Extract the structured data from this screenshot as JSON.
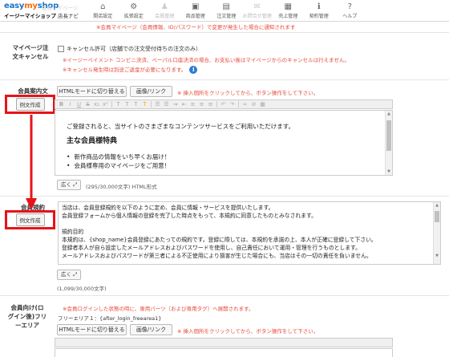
{
  "app": {
    "logo_easy": "easy",
    "logo_my": "my",
    "logo_shop": "shop",
    "subtitle_shop": "イージーマイショップ",
    "subtitle_role": "店長ナビ",
    "ghost_tip": "会員マイページ"
  },
  "nav": [
    {
      "label": "開店設定",
      "icon": "home-icon",
      "glyph": "⌂",
      "enabled": true
    },
    {
      "label": "拡張設定",
      "icon": "gear-icon",
      "glyph": "⚙",
      "enabled": true
    },
    {
      "label": "会員管理",
      "icon": "user-icon",
      "glyph": "♟",
      "enabled": false
    },
    {
      "label": "商品管理",
      "icon": "gift-icon",
      "glyph": "▣",
      "enabled": true
    },
    {
      "label": "注文管理",
      "icon": "document-icon",
      "glyph": "▤",
      "enabled": true
    },
    {
      "label": "お問合せ管理",
      "icon": "mail-icon",
      "glyph": "✉",
      "enabled": false
    },
    {
      "label": "売上管理",
      "icon": "calculator-icon",
      "glyph": "▦",
      "enabled": true
    },
    {
      "label": "契約管理",
      "icon": "info-icon",
      "glyph": "ℹ",
      "enabled": true
    },
    {
      "label": "ヘルプ",
      "icon": "question-icon",
      "glyph": "?",
      "enabled": true
    }
  ],
  "top_note": "※会員マイページ（会員情報、ID/パスワード）で変更が発生した場合に通知されます",
  "cancel_section": {
    "label_line1": "マイページ注",
    "label_line2": "文キャンセル",
    "checkbox_label": "キャンセル許可（店舗での注文受付待ちの注文のみ）",
    "checked": false,
    "note1": "※イージーペイメント コンビニ決済、ペーパル口座決済の場合、お支払い後はマイページからのキャンセルは行えません。",
    "note2": "※キャンセル発生時は別途ご返金が必要になります。"
  },
  "guide_section": {
    "label": "会員案内文",
    "example_button": "例文作成",
    "html_mode_button": "HTMLモードに切り替える",
    "image_link_button": "画像/リンク",
    "hint": "※ 挿入個所をクリックしてから、ボタン操作をして下さい。",
    "content": {
      "intro": "ご登録されると、当サイトのさまざまなコンテンツサービスをご利用いただけます。",
      "heading": "主な会員様特典",
      "items": [
        "新作商品の情報をいち早くお届け！",
        "会員様専用のマイページをご用意！"
      ]
    },
    "expand_button": "広く",
    "counter": "(295/30,000文字) HTML形式"
  },
  "terms_section": {
    "label": "会員規約",
    "example_button": "例文作成",
    "lines": [
      "当店は、会員登録規約を以下のように定め、会員に情報・サービスを提供いたします。",
      "会員登録フォームから個人情報の登録を完了した時点をもって、本規約に同意したものとみなされます。",
      "",
      "規約目的",
      "本規約は、{shop_name}会員登録にあたっての規約です。登録に際しては、本規約を承諾の上、本人が正確に登録して下さい。",
      "登録者本人が自ら設定したメールアドレスおよびパスワードを使用し、自己責任において運用・管理を行うものとします。",
      "メールアドレスおよびパスワードが第三者による不正使用により損害が生じた場合にも、当店はその一切の責任を負いません。"
    ],
    "expand_button": "広く",
    "counter": "(1,099/30,000文字)"
  },
  "freearea_section": {
    "label_line1": "会員向け(ロ",
    "label_line2": "グイン後)フリ",
    "label_line3": "ーエリア",
    "note": "※会員ログインした状態の時に、専用パーツ（および専用タグ）へ展開されます。",
    "area_name": "フリーエリア１：{after_login_freearea1}",
    "html_mode_button": "HTMLモードに切り替える",
    "image_link_button": "画像/リンク",
    "hint": "※ 挿入個所をクリックしてから、ボタン操作をして下さい。"
  },
  "colors": {
    "accent": "#1a73c8",
    "brand_orange": "#ff6a00",
    "note_red": "#e64a3c",
    "annotation_red": "#e8131a",
    "info_blue": "#2b7cd3"
  }
}
